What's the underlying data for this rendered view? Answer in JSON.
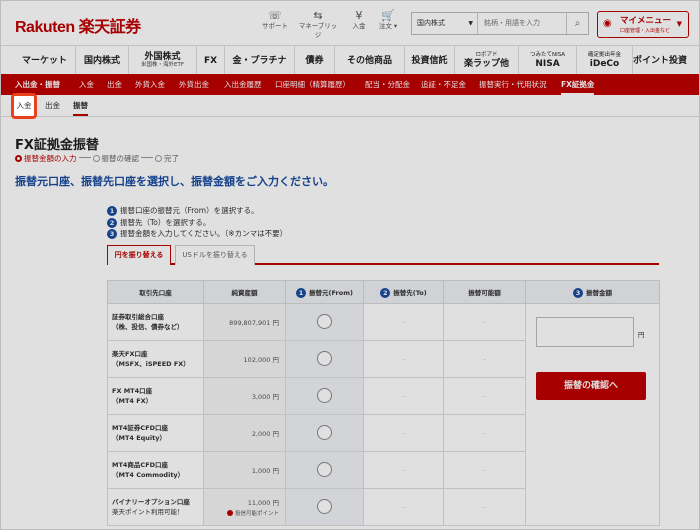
{
  "header": {
    "logo": "Rakuten 楽天証券",
    "icons": [
      {
        "name": "support",
        "label": "サポート",
        "glyph": "☏"
      },
      {
        "name": "money-bridge",
        "label": "マネーブリッジ",
        "glyph": "⇆"
      },
      {
        "name": "deposit",
        "label": "入金",
        "glyph": "¥"
      },
      {
        "name": "order",
        "label": "注文 ▾",
        "glyph": "🛒"
      }
    ],
    "search": {
      "category": "国内株式",
      "placeholder": "銘柄・用語を入力"
    },
    "my_menu": {
      "label": "マイメニュー",
      "sub": "口座管理・入出金など"
    }
  },
  "main_nav": [
    {
      "label": "マーケット",
      "sub": ""
    },
    {
      "label": "国内株式",
      "sub": ""
    },
    {
      "label": "外国株式",
      "sub": "米国株・海外ETF"
    },
    {
      "label": "FX",
      "sub": ""
    },
    {
      "label": "金・プラチナ",
      "sub": ""
    },
    {
      "label": "債券",
      "sub": ""
    },
    {
      "label": "その他商品",
      "sub": ""
    },
    {
      "label": "投資信託",
      "sub": ""
    },
    {
      "label": "楽ラップ他",
      "top": "ロボアド"
    },
    {
      "label": "NISA",
      "top": "つみたてNISA"
    },
    {
      "label": "iDeCo",
      "top": "確定拠出年金"
    },
    {
      "label": "ポイント投資",
      "sub": ""
    }
  ],
  "sub_nav": [
    "入出金・振替",
    "入金",
    "出金",
    "外貨入金",
    "外貨出金",
    "入出金履歴",
    "口座明細（精算履歴）",
    "配当・分配金",
    "追証・不足金",
    "振替実行・代用状況",
    "FX証拠金"
  ],
  "tert_nav": [
    "入金",
    "出金",
    "振替"
  ],
  "page": {
    "title": "FX証拠金振替",
    "steps": [
      "振替金額の入力",
      "振替の確認",
      "完了"
    ],
    "lead": "振替元口座、振替先口座を選択し、振替金額をご入力ください。",
    "instructions": [
      {
        "n": "1",
        "text": "振替口座の振替元（From）を選択する。"
      },
      {
        "n": "2",
        "text": "振替先（To）を選択する。"
      },
      {
        "n": "3",
        "text": "振替金額を入力してください。（※カンマは不要）"
      }
    ],
    "currency_tabs": [
      "円を振り替える",
      "USドルを振り替える"
    ]
  },
  "table": {
    "headers": [
      "取引先口座",
      "純資産額",
      "振替元(From)",
      "振替先(To)",
      "振替可能額",
      "振替金額"
    ],
    "header_nums": [
      "",
      "",
      "1",
      "2",
      "",
      "3"
    ],
    "rows": [
      {
        "name": "証券取引総合口座",
        "sub": "（株、投信、債券など）",
        "balance": "899,807,901 円",
        "to": "-",
        "avail": "-"
      },
      {
        "name": "楽天FX口座",
        "sub": "（MSFX、iSPEED FX）",
        "balance": "102,000 円",
        "to": "-",
        "avail": "-"
      },
      {
        "name": "FX MT4口座",
        "sub": "（MT4 FX）",
        "balance": "3,000 円",
        "to": "-",
        "avail": "-"
      },
      {
        "name": "MT4証券CFD口座",
        "sub": "（MT4 Equity）",
        "balance": "2,000 円",
        "to": "-",
        "avail": "-"
      },
      {
        "name": "MT4商品CFD口座",
        "sub": "（MT4 Commodity）",
        "balance": "1,000 円",
        "to": "-",
        "avail": "-"
      },
      {
        "name": "バイナリーオプション口座",
        "sub": "楽天ポイント利用可能！",
        "balance": "11,000 円",
        "points": "投信可能ポイント",
        "to": "-",
        "avail": "-"
      }
    ],
    "amount_unit": "円",
    "confirm_button": "振替の確認へ"
  },
  "colors": {
    "brand": "#bf0000",
    "lead": "#1a4ca0",
    "highlight": "#e8421c"
  }
}
